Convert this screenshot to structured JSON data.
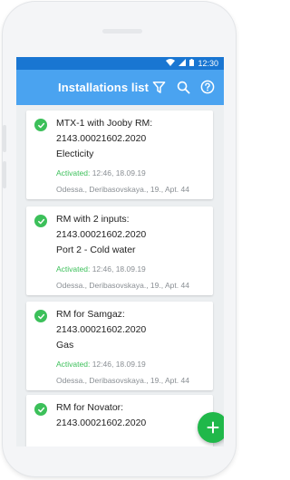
{
  "status_bar": {
    "time": "12:30",
    "icons": [
      "wifi-icon",
      "signal-icon",
      "battery-icon"
    ]
  },
  "app_bar": {
    "title": "Installations list",
    "actions": [
      "filter-icon",
      "search-icon",
      "help-icon"
    ],
    "color": "#4aa3f0"
  },
  "installations": [
    {
      "name": "MTX-1 with Jooby RM:",
      "serial": "2143.00021602.2020",
      "type": "Electicity",
      "activated_label": "Activated:",
      "activated_at": "12:46, 18.09.19",
      "address": "Odessa., Deribasovskaya., 19., Apt. 44"
    },
    {
      "name": "RM with 2 inputs:",
      "serial": "2143.00021602.2020",
      "type": "Port 2 - Cold water",
      "activated_label": "Activated:",
      "activated_at": "12:46, 18.09.19",
      "address": "Odessa., Deribasovskaya., 19., Apt. 44"
    },
    {
      "name": "RM for Samgaz:",
      "serial": "2143.00021602.2020",
      "type": "Gas",
      "activated_label": "Activated:",
      "activated_at": "12:46, 18.09.19",
      "address": "Odessa., Deribasovskaya., 19., Apt. 44"
    },
    {
      "name": "RM for Novator:",
      "serial": "2143.00021602.2020"
    }
  ],
  "fab": {
    "icon": "plus-icon",
    "color": "#20b84a"
  },
  "colors": {
    "accent_green": "#3cc05a",
    "status_bar": "#1976d2"
  }
}
